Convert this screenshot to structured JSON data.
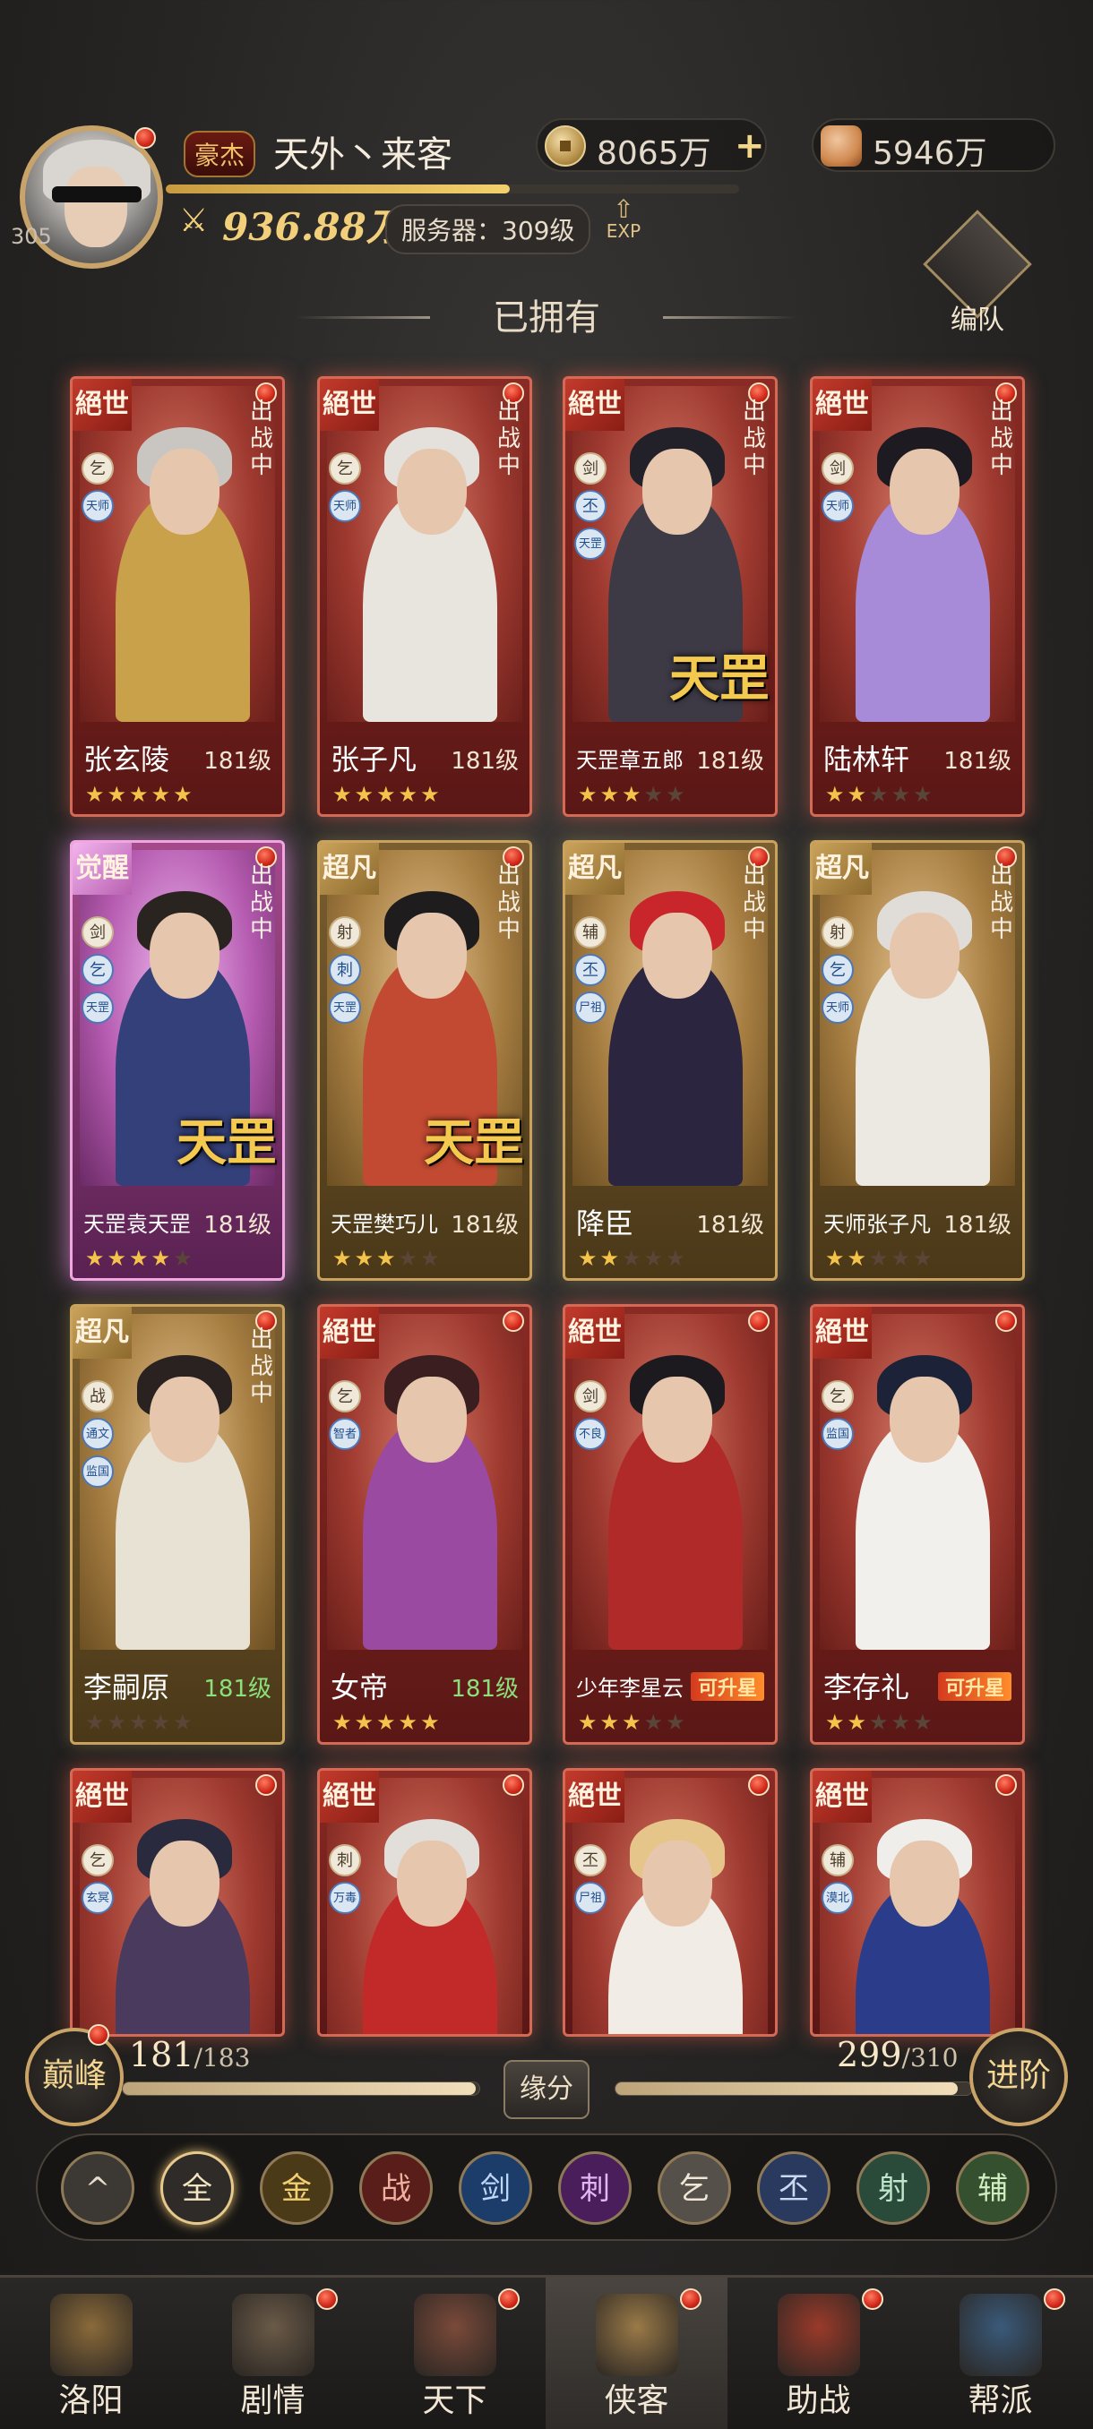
{
  "player": {
    "level": "305",
    "rank": "豪杰",
    "name": "天外丶来客",
    "power": "936.88万",
    "server": "服务器：309级",
    "exp_label": "EXP",
    "exp_fraction": 0.6
  },
  "currency": {
    "coins": "8065万",
    "coin_icon": "coin-icon",
    "books": "5946万",
    "book_icon": "book-icon",
    "plus": "+"
  },
  "section_title": "已拥有",
  "team_button": "编队",
  "cards": [
    {
      "tier": "絕世",
      "style": "red",
      "name": "张玄陵",
      "level": "181级",
      "stars": 5,
      "battle": "出战中",
      "tags": [
        "乞",
        "天师"
      ],
      "stamp": "",
      "hair": "#c9c6c2",
      "robe": "#c9a14a"
    },
    {
      "tier": "絕世",
      "style": "red",
      "name": "张子凡",
      "level": "181级",
      "stars": 5,
      "battle": "出战中",
      "tags": [
        "乞",
        "天师"
      ],
      "stamp": "",
      "hair": "#e4e1dc",
      "robe": "#e8e4de"
    },
    {
      "tier": "絕世",
      "style": "red",
      "name": "天罡章五郎",
      "level": "181级",
      "stars": 3,
      "battle": "出战中",
      "tags": [
        "剑",
        "丕",
        "天罡"
      ],
      "stamp": "天罡",
      "hair": "#222028",
      "robe": "#3d3a46"
    },
    {
      "tier": "絕世",
      "style": "red",
      "name": "陆林轩",
      "level": "181级",
      "stars": 2,
      "battle": "出战中",
      "tags": [
        "剑",
        "天师"
      ],
      "stamp": "",
      "hair": "#1e1a22",
      "robe": "#a78bd8"
    },
    {
      "tier": "觉醒",
      "style": "pink",
      "name": "天罡袁天罡",
      "level": "181级",
      "stars": 4,
      "battle": "出战中",
      "tags": [
        "剑",
        "乞",
        "天罡"
      ],
      "stamp": "天罡",
      "hair": "#2a2420",
      "robe": "#34407a"
    },
    {
      "tier": "超凡",
      "style": "gold",
      "name": "天罡樊巧儿",
      "level": "181级",
      "stars": 3,
      "battle": "出战中",
      "tags": [
        "射",
        "刺",
        "天罡"
      ],
      "stamp": "天罡",
      "hair": "#1e1c1c",
      "robe": "#c24a32"
    },
    {
      "tier": "超凡",
      "style": "gold",
      "name": "降臣",
      "level": "181级",
      "stars": 2,
      "battle": "出战中",
      "tags": [
        "辅",
        "丕",
        "尸祖"
      ],
      "stamp": "",
      "hair": "#c8262a",
      "robe": "#2b2540"
    },
    {
      "tier": "超凡",
      "style": "gold",
      "name": "天师张子凡",
      "level": "181级",
      "stars": 2,
      "battle": "出战中",
      "tags": [
        "射",
        "乞",
        "天师"
      ],
      "stamp": "",
      "hair": "#e0ddd8",
      "robe": "#ece8e2"
    },
    {
      "tier": "超凡",
      "style": "gold",
      "name": "李嗣原",
      "level": "181级",
      "level_color": "green",
      "stars": 0,
      "battle": "出战中",
      "tags": [
        "战",
        "通文",
        "监国"
      ],
      "stamp": "",
      "hair": "#2a2220",
      "robe": "#e8e2d4"
    },
    {
      "tier": "絕世",
      "style": "red",
      "name": "女帝",
      "level": "181级",
      "level_color": "green",
      "stars": 5,
      "battle": "",
      "tags": [
        "乞",
        "智者"
      ],
      "stamp": "",
      "hair": "#3a1e20",
      "robe": "#9a4aa0"
    },
    {
      "tier": "絕世",
      "style": "red",
      "name": "少年李星云",
      "level": "可升星",
      "level_color": "up",
      "stars": 3,
      "battle": "",
      "tags": [
        "剑",
        "不良"
      ],
      "stamp": "",
      "hair": "#1c1a1e",
      "robe": "#b02a2a"
    },
    {
      "tier": "絕世",
      "style": "red",
      "name": "李存礼",
      "level": "可升星",
      "level_color": "up",
      "stars": 2,
      "battle": "",
      "tags": [
        "乞",
        "监国"
      ],
      "stamp": "",
      "hair": "#1c2238",
      "robe": "#f2f0ec"
    },
    {
      "tier": "絕世",
      "style": "red",
      "name": "",
      "level": "",
      "stars": 0,
      "battle": "",
      "tags": [
        "乞",
        "玄冥"
      ],
      "stamp": "",
      "hair": "#2a2a3e",
      "robe": "#4a3a5e"
    },
    {
      "tier": "絕世",
      "style": "red",
      "name": "",
      "level": "",
      "stars": 0,
      "battle": "",
      "tags": [
        "刺",
        "万毒"
      ],
      "stamp": "",
      "hair": "#e2dfda",
      "robe": "#c22a2a"
    },
    {
      "tier": "絕世",
      "style": "red",
      "name": "",
      "level": "",
      "stars": 0,
      "battle": "",
      "tags": [
        "丕",
        "尸祖"
      ],
      "stamp": "",
      "hair": "#e6c58a",
      "robe": "#f1ede6"
    },
    {
      "tier": "絕世",
      "style": "red",
      "name": "",
      "level": "",
      "stars": 0,
      "battle": "",
      "tags": [
        "辅",
        "漠北"
      ],
      "stamp": "",
      "hair": "#f0eeea",
      "robe": "#2a3c8a"
    }
  ],
  "progress": {
    "peak_label": "巅峰",
    "left_value": "181",
    "left_max": "/183",
    "left_fraction": 0.99,
    "fate_label": "缘分",
    "right_value": "299",
    "right_max": "/310",
    "right_fraction": 0.96,
    "advance_label": "进阶"
  },
  "filters": [
    {
      "label": "^",
      "icon": "collapse-icon",
      "bg": "#3c3834",
      "fg": "#e8dccb"
    },
    {
      "label": "全",
      "bg": "#2e2b28",
      "fg": "#f4e4c0"
    },
    {
      "label": "金",
      "bg": "#4a3a18",
      "fg": "#f2cf72"
    },
    {
      "label": "战",
      "bg": "#5a1e1a",
      "fg": "#f0b0a0"
    },
    {
      "label": "剑",
      "bg": "#1c3c6a",
      "fg": "#bfd6f6"
    },
    {
      "label": "刺",
      "bg": "#4a1e5a",
      "fg": "#e2b6f2"
    },
    {
      "label": "乞",
      "bg": "#55504a",
      "fg": "#f0e6d6"
    },
    {
      "label": "丕",
      "bg": "#2a3a5e",
      "fg": "#cbd8f2"
    },
    {
      "label": "射",
      "bg": "#2a4a3a",
      "fg": "#bfe6cc"
    },
    {
      "label": "辅",
      "bg": "#34502e",
      "fg": "#cfeec0"
    }
  ],
  "nav": [
    {
      "label": "洛阳",
      "icon": "palace-icon",
      "color": "#8a6a3a",
      "dot": false,
      "active": false
    },
    {
      "label": "剧情",
      "icon": "scroll-icon",
      "color": "#6a5a48",
      "dot": true,
      "active": false
    },
    {
      "label": "天下",
      "icon": "peach-icon",
      "color": "#7a4a3a",
      "dot": true,
      "active": false
    },
    {
      "label": "侠客",
      "icon": "hat-icon",
      "color": "#9a7a48",
      "dot": true,
      "active": true
    },
    {
      "label": "助战",
      "icon": "banner-icon",
      "color": "#9a3a2a",
      "dot": true,
      "active": false
    },
    {
      "label": "帮派",
      "icon": "crest-icon",
      "color": "#3a5a7a",
      "dot": true,
      "active": false
    }
  ]
}
